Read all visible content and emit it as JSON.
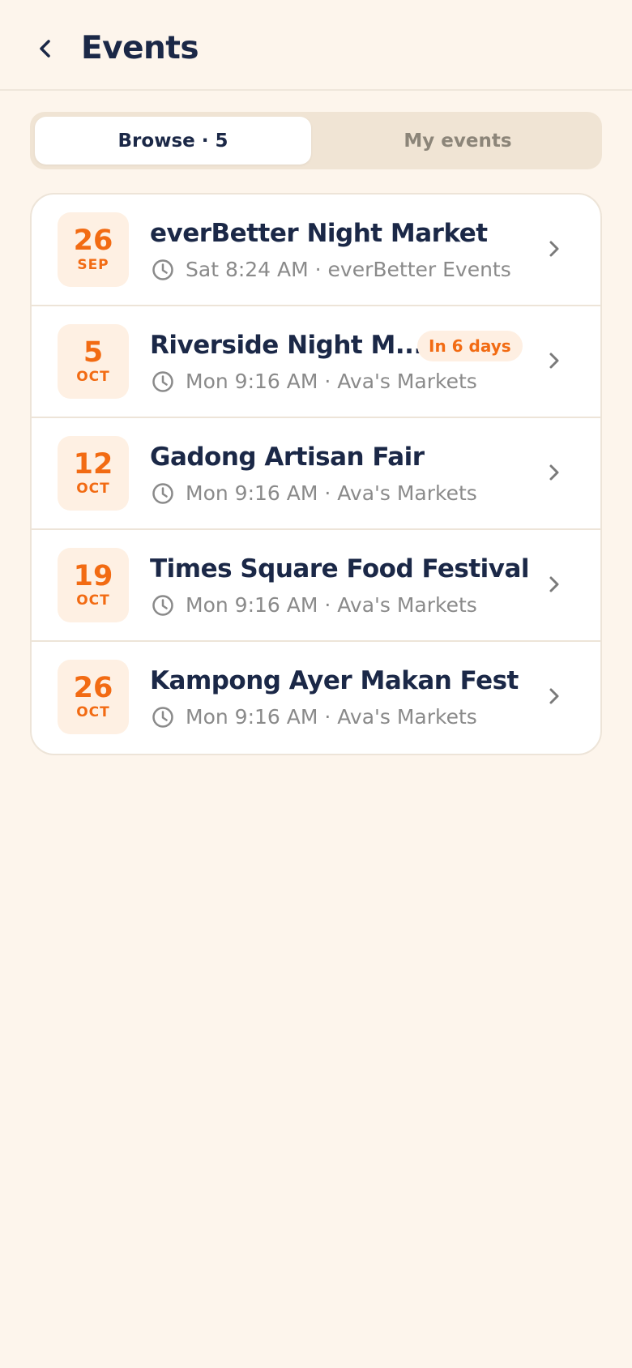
{
  "header": {
    "title": "Events"
  },
  "tabs": [
    {
      "label": "Browse · 5",
      "active": true
    },
    {
      "label": "My events",
      "active": false
    }
  ],
  "events": [
    {
      "day": "26",
      "month": "SEP",
      "title": "everBetter Night Market",
      "meta": "Sat 8:24 AM · everBetter Events",
      "badge": ""
    },
    {
      "day": "5",
      "month": "OCT",
      "title": "Riverside Night M...",
      "meta": "Mon 9:16 AM · Ava's Markets",
      "badge": "In 6 days"
    },
    {
      "day": "12",
      "month": "OCT",
      "title": "Gadong Artisan Fair",
      "meta": "Mon 9:16 AM · Ava's Markets",
      "badge": ""
    },
    {
      "day": "19",
      "month": "OCT",
      "title": "Times Square Food Festival",
      "meta": "Mon 9:16 AM · Ava's Markets",
      "badge": ""
    },
    {
      "day": "26",
      "month": "OCT",
      "title": "Kampong Ayer Makan Fest",
      "meta": "Mon 9:16 AM · Ava's Markets",
      "badge": ""
    }
  ],
  "icons": {
    "back": "chevron-left-icon",
    "clock": "clock-icon",
    "row_chevron": "chevron-right-icon"
  },
  "colors": {
    "background": "#FDF5EC",
    "accent": "#F26B13",
    "title": "#1B2847",
    "muted": "#8A8A8A",
    "segment_bg": "#F0E4D4"
  }
}
